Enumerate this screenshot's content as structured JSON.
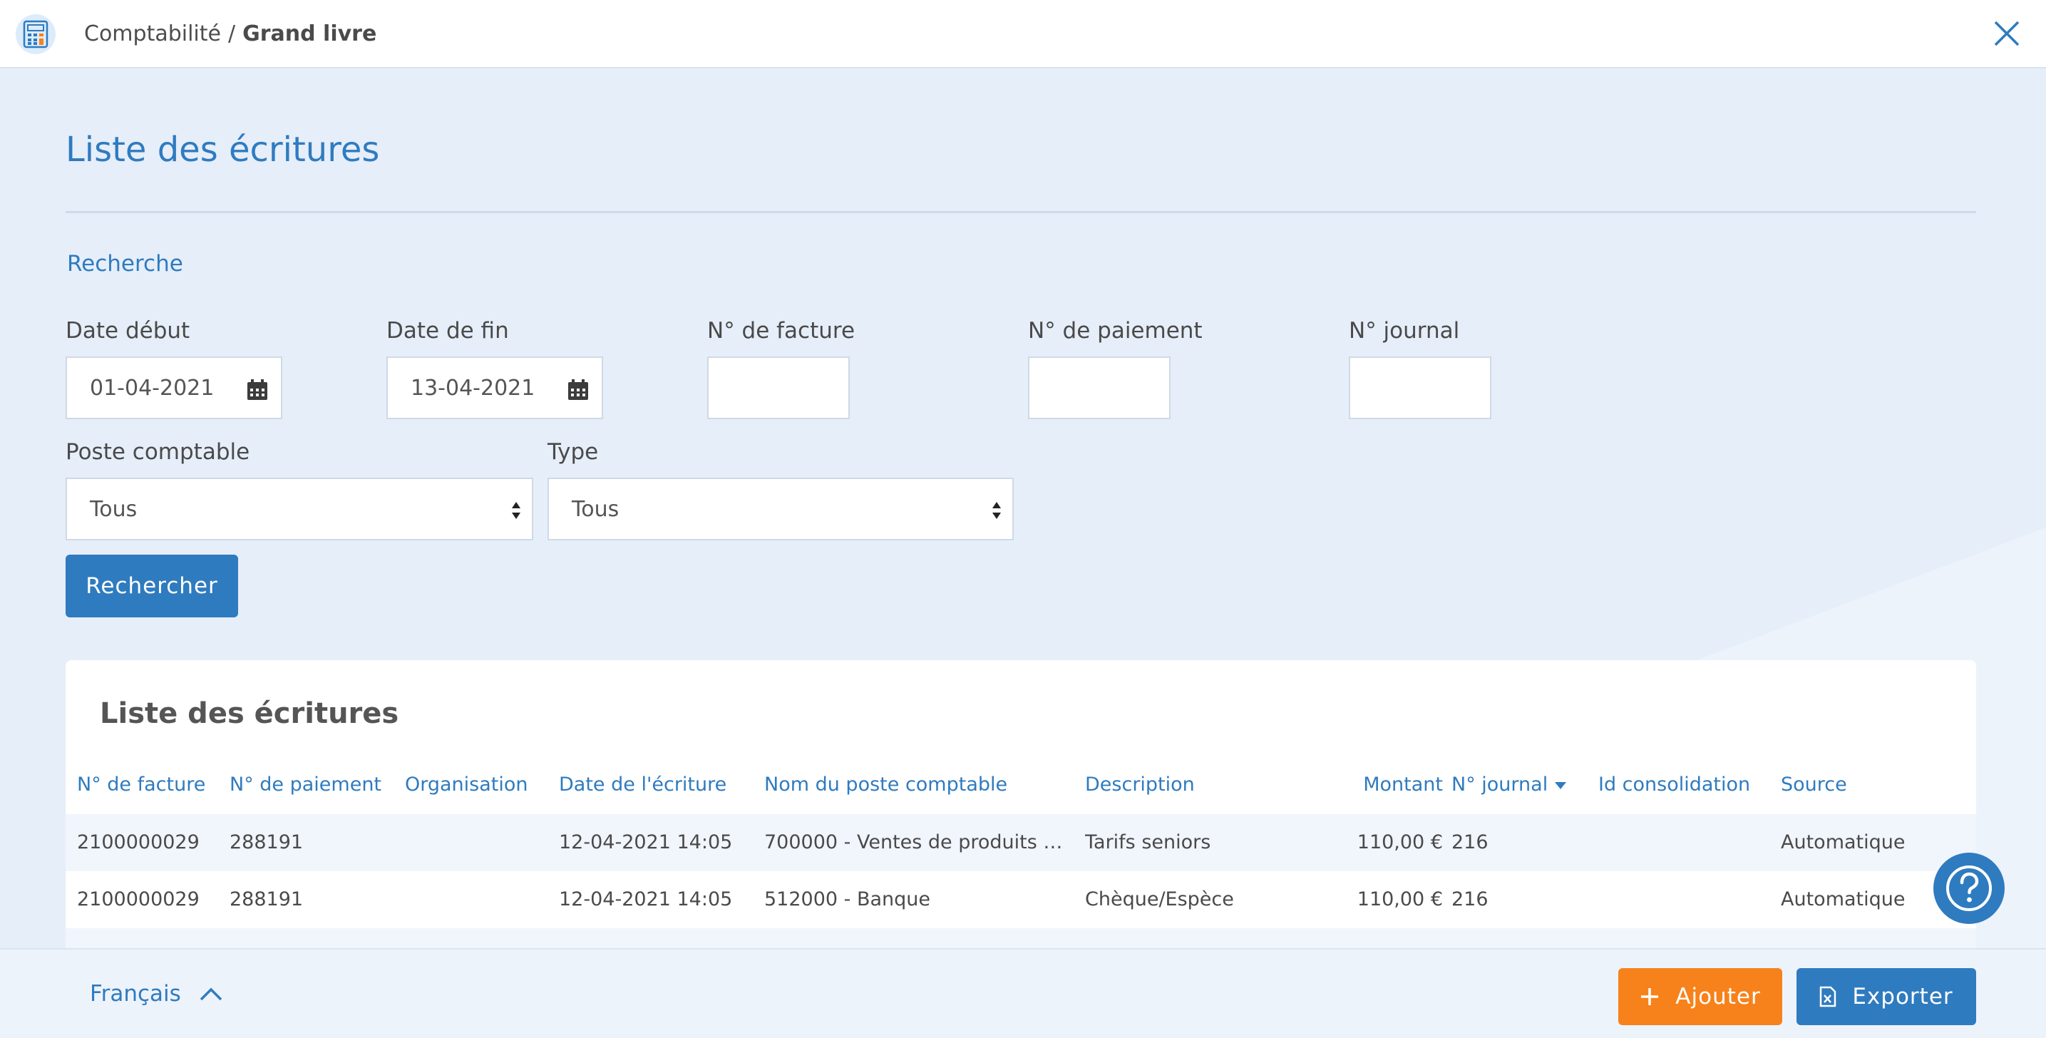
{
  "header": {
    "app_icon": "calculator-icon",
    "breadcrumb_parent": "Comptabilité",
    "breadcrumb_separator": "/",
    "breadcrumb_current": "Grand livre",
    "close_icon": "close-icon"
  },
  "page": {
    "title": "Liste des écritures",
    "search_section": "Recherche"
  },
  "form": {
    "date_start": {
      "label": "Date début",
      "value": "01-04-2021"
    },
    "date_end": {
      "label": "Date de fin",
      "value": "13-04-2021"
    },
    "invoice_no": {
      "label": "N° de facture",
      "value": ""
    },
    "payment_no": {
      "label": "N° de paiement",
      "value": ""
    },
    "journal_no": {
      "label": "N° journal",
      "value": ""
    },
    "account_post": {
      "label": "Poste comptable",
      "value": "Tous"
    },
    "type": {
      "label": "Type",
      "value": "Tous"
    },
    "search_button": "Rechercher"
  },
  "table": {
    "title": "Liste des écritures",
    "columns": [
      "N° de facture",
      "N° de paiement",
      "Organisation",
      "Date de l'écriture",
      "Nom du poste comptable",
      "Description",
      "Montant",
      "N° journal",
      "Id consolidation",
      "Source"
    ],
    "sorted_column": "N° journal",
    "sort_direction": "desc",
    "rows": [
      {
        "invoice": "2100000029",
        "payment": "288191",
        "organisation": "",
        "date": "12-04-2021 14:05",
        "account": "700000 - Ventes de produits finis...",
        "description": "Tarifs seniors",
        "amount": "110,00 €",
        "journal": "216",
        "consolidation": "",
        "source": "Automatique"
      },
      {
        "invoice": "2100000029",
        "payment": "288191",
        "organisation": "",
        "date": "12-04-2021 14:05",
        "account": "512000 - Banque",
        "description": "Chèque/Espèce",
        "amount": "110,00 €",
        "journal": "216",
        "consolidation": "",
        "source": "Automatique"
      }
    ]
  },
  "footer": {
    "language": "Français",
    "add_button": "Ajouter",
    "export_button": "Exporter"
  },
  "colors": {
    "primary": "#2f7bbf",
    "accent": "#f7821b",
    "background": "#e6eef9"
  },
  "icons": {
    "help": "help-question-icon",
    "calendar": "calendar-icon",
    "plus": "plus-icon",
    "export": "excel-file-icon",
    "language_toggle": "chevron-up-icon",
    "sort": "caret-down-icon"
  }
}
